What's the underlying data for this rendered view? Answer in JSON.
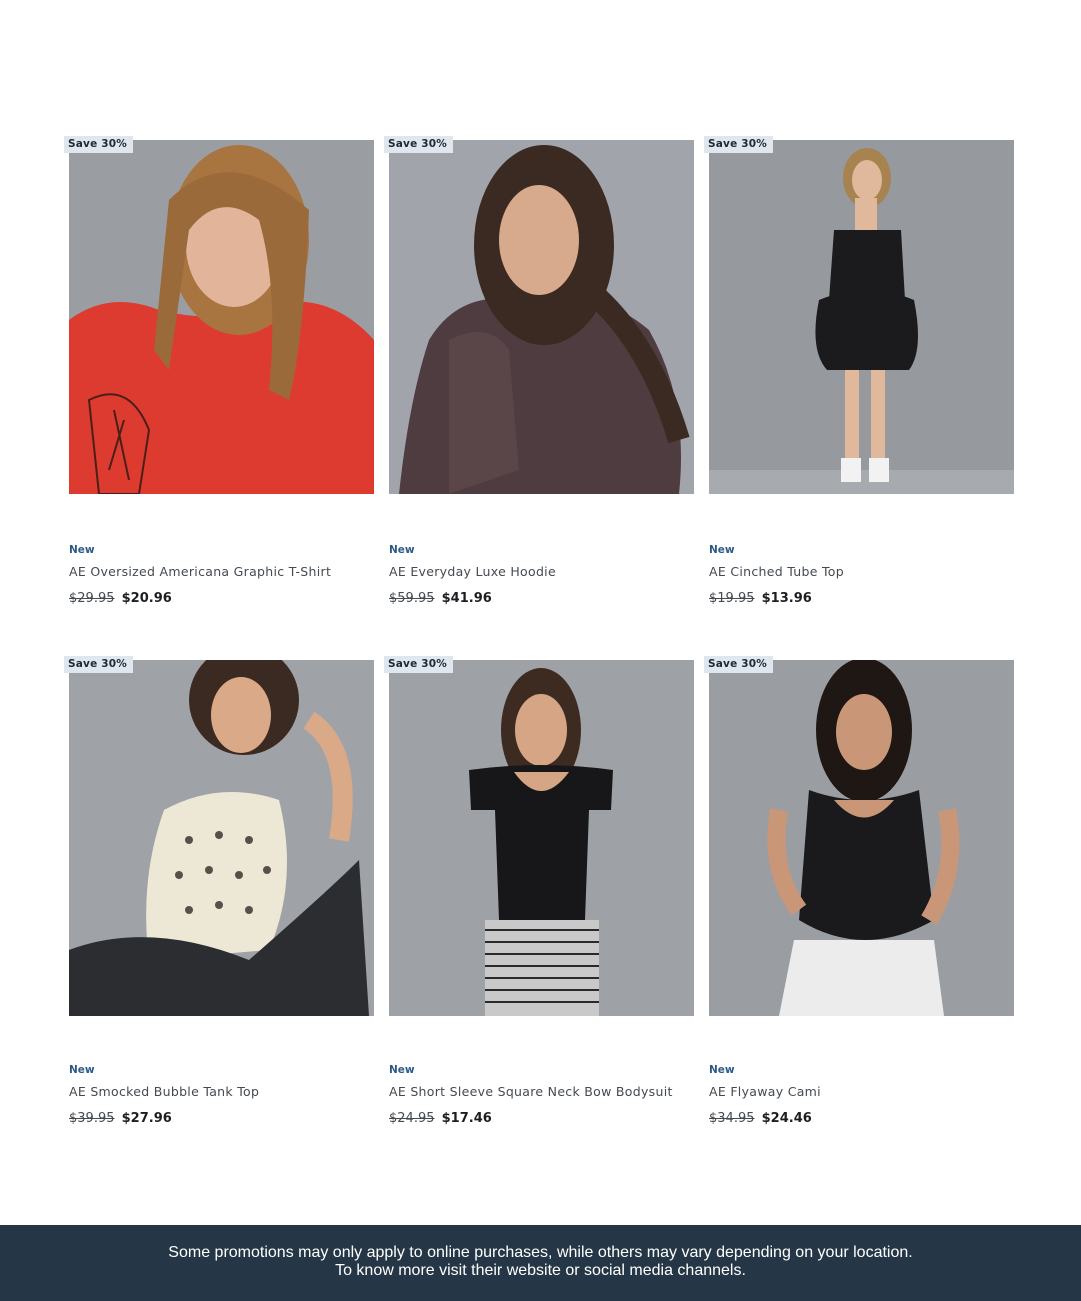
{
  "products": [
    {
      "badge": "Save 30%",
      "tag": "New",
      "name": "AE Oversized Americana Graphic T-Shirt",
      "old_price": "$29.95",
      "price": "$20.96"
    },
    {
      "badge": "Save 30%",
      "tag": "New",
      "name": "AE Everyday Luxe Hoodie",
      "old_price": "$59.95",
      "price": "$41.96"
    },
    {
      "badge": "Save 30%",
      "tag": "New",
      "name": "AE Cinched Tube Top",
      "old_price": "$19.95",
      "price": "$13.96"
    },
    {
      "badge": "Save 30%",
      "tag": "New",
      "name": "AE Smocked Bubble Tank Top",
      "old_price": "$39.95",
      "price": "$27.96"
    },
    {
      "badge": "Save 30%",
      "tag": "New",
      "name": "AE Short Sleeve Square Neck Bow Bodysuit",
      "old_price": "$24.95",
      "price": "$17.46"
    },
    {
      "badge": "Save 30%",
      "tag": "New",
      "name": "AE Flyaway Cami",
      "old_price": "$34.95",
      "price": "$24.46"
    }
  ],
  "footer": {
    "line1": "Some promotions may only apply to online purchases, while others may vary depending on your location.",
    "line2": "To know more visit their website or social media channels."
  },
  "colors": {
    "footer_bg": "#253746",
    "badge_bg": "#dfe6ee",
    "new_label": "#2c5a86"
  }
}
